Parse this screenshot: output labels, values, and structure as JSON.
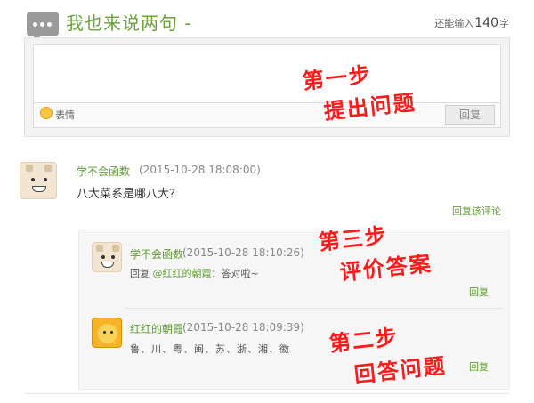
{
  "header": {
    "title": "我也来说两句 -",
    "counter_prefix": "还能输入",
    "counter_value": "140",
    "counter_suffix": "字"
  },
  "compose": {
    "emoji_label": "表情",
    "reply_button": "回复"
  },
  "comment": {
    "username": "学不会函数",
    "time": "(2015-10-28 18:08:00)",
    "text": "八大菜系是哪八大？",
    "reply_link": "回复该评论"
  },
  "replies": [
    {
      "username": "学不会函数",
      "time": "(2015-10-28 18:10:26)",
      "prefix": "回复",
      "mention": "@红红的朝霞",
      "text": "：答对啦~",
      "reply_link": "回复"
    },
    {
      "username": "红红的朝霞",
      "time": "(2015-10-28 18:09:39)",
      "text": "鲁、川、粤、闽、苏、浙、湘、徽",
      "reply_link": "回复"
    }
  ],
  "annotations": {
    "step1_a": "第一步",
    "step1_b": "提出问题",
    "step3_a": "第三步",
    "step3_b": "评价答案",
    "step2_a": "第二步",
    "step2_b": "回答问题"
  },
  "colors": {
    "brand_green": "#6aa33c",
    "annotation_red": "#ff1a1a"
  }
}
